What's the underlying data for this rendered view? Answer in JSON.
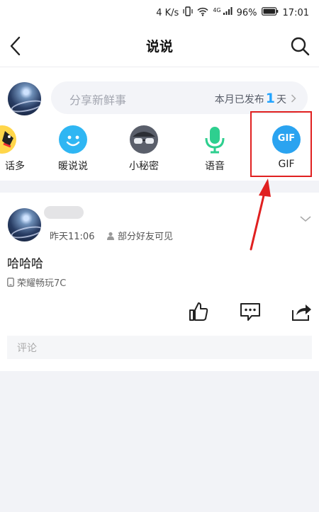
{
  "status_bar": {
    "speed": "4 K/s",
    "network": "4G",
    "battery": "96%",
    "time": "17:01"
  },
  "header": {
    "title": "说说"
  },
  "composer": {
    "placeholder": "分享新鲜事",
    "stat_prefix": "本月已发布",
    "stat_count": "1",
    "stat_suffix": "天"
  },
  "quick_actions": [
    {
      "label": "话多",
      "icon": "chat-cartoon-icon"
    },
    {
      "label": "暖说说",
      "icon": "warm-smile-icon"
    },
    {
      "label": "小秘密",
      "icon": "secret-mask-icon"
    },
    {
      "label": "语音",
      "icon": "microphone-icon"
    },
    {
      "label": "GIF",
      "icon": "gif-icon"
    }
  ],
  "gif_icon_text": "GIF",
  "post": {
    "time": "昨天11:06",
    "privacy": "部分好友可见",
    "text": "哈哈哈",
    "device": "荣耀畅玩7C"
  },
  "comment": {
    "placeholder": "评论"
  },
  "colors": {
    "accent": "#23a4ff",
    "highlight": "#e02020",
    "voice": "#2ecf8f"
  }
}
